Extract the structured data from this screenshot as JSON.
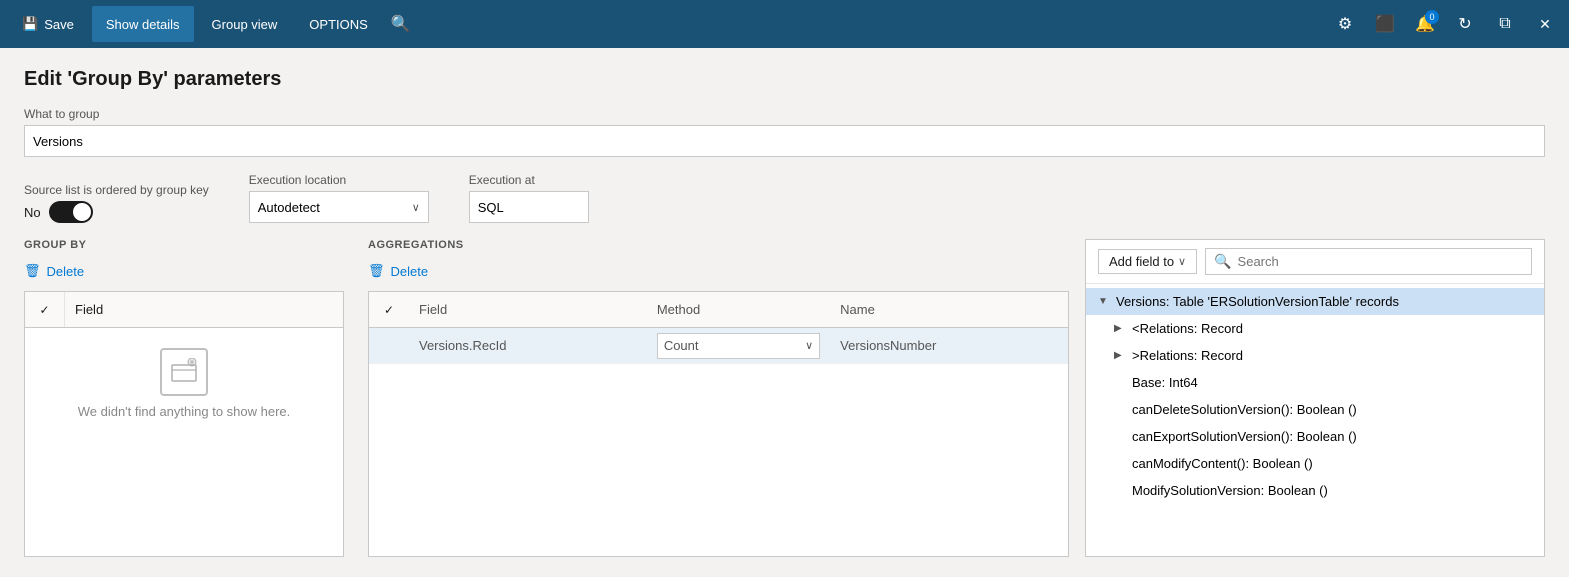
{
  "titlebar": {
    "save_label": "Save",
    "show_details_label": "Show details",
    "group_view_label": "Group view",
    "options_label": "OPTIONS",
    "notification_count": "0"
  },
  "page": {
    "title": "Edit 'Group By' parameters"
  },
  "form": {
    "what_to_group_label": "What to group",
    "what_to_group_value": "Versions",
    "source_ordered_label": "Source list is ordered by group key",
    "toggle_value": "No",
    "execution_location_label": "Execution location",
    "execution_location_value": "Autodetect",
    "execution_at_label": "Execution at",
    "execution_at_value": "SQL"
  },
  "group_by": {
    "header": "GROUP BY",
    "delete_label": "Delete",
    "col_field": "Field",
    "empty_message": "We didn't find anything to show here."
  },
  "aggregations": {
    "header": "AGGREGATIONS",
    "delete_label": "Delete",
    "col_field": "Field",
    "col_method": "Method",
    "col_name": "Name",
    "rows": [
      {
        "field": "Versions.RecId",
        "method": "Count",
        "name": "VersionsNumber"
      }
    ]
  },
  "right_panel": {
    "add_field_label": "Add field to",
    "search_placeholder": "Search",
    "tree_items": [
      {
        "level": 0,
        "arrow": "▼",
        "label": "Versions: Table 'ERSolutionVersionTable' records",
        "highlighted": true
      },
      {
        "level": 1,
        "arrow": "▶",
        "label": "<Relations: Record",
        "highlighted": false
      },
      {
        "level": 1,
        "arrow": "▶",
        "label": ">Relations: Record",
        "highlighted": false
      },
      {
        "level": 1,
        "arrow": "",
        "label": "Base: Int64",
        "highlighted": false
      },
      {
        "level": 1,
        "arrow": "",
        "label": "canDeleteSolutionVersion(): Boolean ()",
        "highlighted": false
      },
      {
        "level": 1,
        "arrow": "",
        "label": "canExportSolutionVersion(): Boolean ()",
        "highlighted": false
      },
      {
        "level": 1,
        "arrow": "",
        "label": "canModifyContent(): Boolean ()",
        "highlighted": false
      },
      {
        "level": 1,
        "arrow": "",
        "label": "ModifySolutionVersion: Boolean ()",
        "highlighted": false
      }
    ]
  }
}
